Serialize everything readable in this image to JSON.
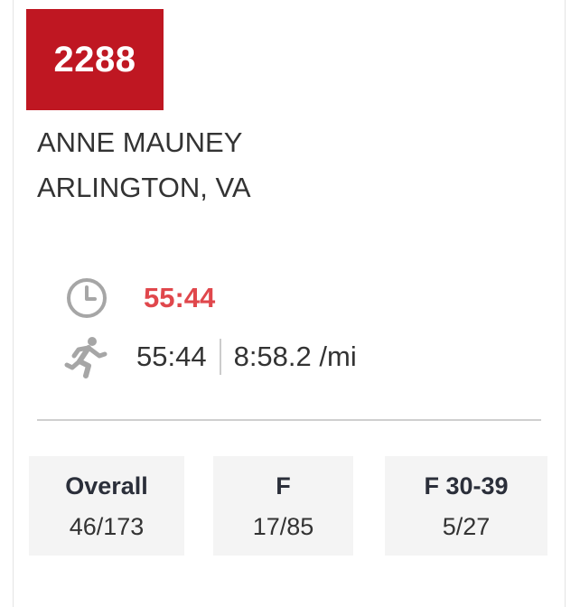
{
  "runner": {
    "bib": "2288",
    "name": "ANNE MAUNEY",
    "location": "ARLINGTON, VA"
  },
  "times": {
    "gun_time": "55:44",
    "chip_time": "55:44",
    "pace": "8:58.2 /mi"
  },
  "icons": {
    "clock": "clock-icon",
    "runner": "runner-icon"
  },
  "placements": [
    {
      "label": "Overall",
      "value": "46/173"
    },
    {
      "label": "F",
      "value": "17/85"
    },
    {
      "label": "F 30-39",
      "value": "5/27"
    }
  ],
  "colors": {
    "bib_background": "#bf1722",
    "gun_time": "#e0474c"
  }
}
